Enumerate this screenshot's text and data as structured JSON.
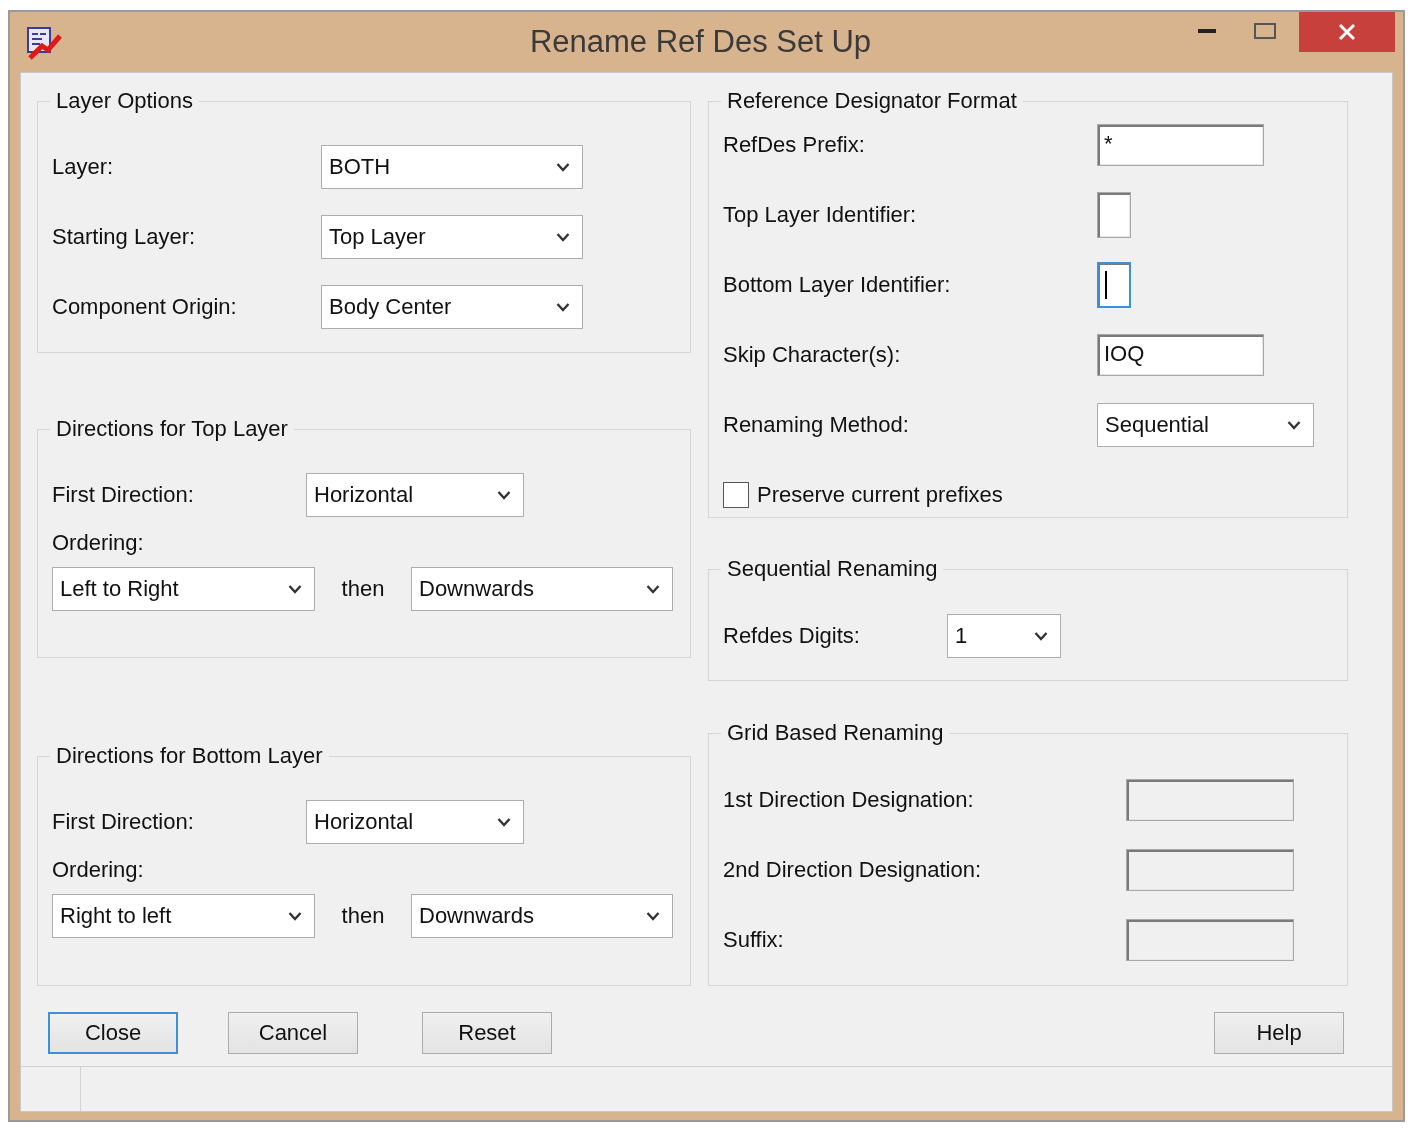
{
  "window": {
    "title": "Rename Ref Des Set Up"
  },
  "layer_options": {
    "title": "Layer Options",
    "fields": [
      {
        "label": "Layer:",
        "value": "BOTH"
      },
      {
        "label": "Starting Layer:",
        "value": "Top Layer"
      },
      {
        "label": "Component Origin:",
        "value": "Body Center"
      }
    ]
  },
  "top_layer_directions": {
    "title": "Directions for Top Layer",
    "first_direction": {
      "label": "First Direction:",
      "value": "Horizontal"
    },
    "ordering": {
      "label": "Ordering:",
      "first": "Left to Right",
      "connector": "then",
      "second": "Downwards"
    }
  },
  "bottom_layer_directions": {
    "title": "Directions for Bottom Layer",
    "first_direction": {
      "label": "First Direction:",
      "value": "Horizontal"
    },
    "ordering": {
      "label": "Ordering:",
      "first": "Right to left",
      "connector": "then",
      "second": "Downwards"
    }
  },
  "reference_designator_format": {
    "title": "Reference Designator Format",
    "fields": [
      {
        "kind": "text",
        "label": "RefDes Prefix:",
        "value": "*",
        "focused": false
      },
      {
        "kind": "char",
        "label": "Top Layer Identifier:",
        "focused": false
      },
      {
        "kind": "char",
        "label": "Bottom Layer Identifier:",
        "focused": true
      },
      {
        "kind": "text",
        "label": "Skip Character(s):",
        "value": "IOQ",
        "focused": false
      },
      {
        "kind": "select",
        "label": "Renaming Method:",
        "value": "Sequential",
        "focused": false
      }
    ],
    "checkbox": {
      "label": "Preserve current prefixes",
      "checked": false
    }
  },
  "sequential_renaming": {
    "title": "Sequential Renaming",
    "fields": [
      {
        "label": "Refdes Digits:",
        "value": "1"
      }
    ]
  },
  "grid_based_renaming": {
    "title": "Grid Based Renaming",
    "fields": [
      {
        "label": "1st Direction Designation:",
        "disabled": true
      },
      {
        "label": "2nd Direction Designation:",
        "disabled": true
      },
      {
        "label": "Suffix:",
        "disabled": true
      }
    ]
  },
  "buttons": [
    {
      "label": "Close",
      "default": true
    },
    {
      "label": "Cancel",
      "default": false
    },
    {
      "label": "Reset",
      "default": false
    }
  ],
  "help_button": {
    "label": "Help",
    "default": false
  }
}
